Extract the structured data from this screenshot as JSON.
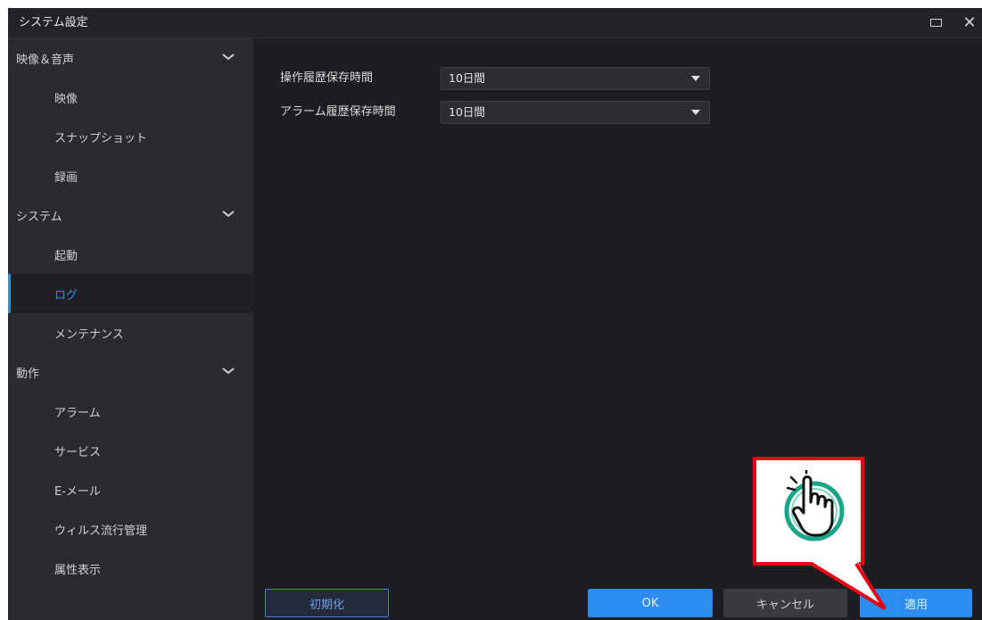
{
  "window": {
    "title": "システム設定",
    "controls": {
      "maximize_icon": "maximize-icon",
      "close_icon": "close-icon",
      "close_glyph": "✕"
    }
  },
  "sidebar": {
    "items": [
      {
        "label": "映像＆音声",
        "type": "group",
        "expanded": true
      },
      {
        "label": "映像",
        "type": "item"
      },
      {
        "label": "スナップショット",
        "type": "item"
      },
      {
        "label": "録画",
        "type": "item"
      },
      {
        "label": "システム",
        "type": "group",
        "expanded": true
      },
      {
        "label": "起動",
        "type": "item"
      },
      {
        "label": "ログ",
        "type": "item",
        "selected": true
      },
      {
        "label": "メンテナンス",
        "type": "item"
      },
      {
        "label": "動作",
        "type": "group",
        "expanded": true
      },
      {
        "label": "アラーム",
        "type": "item"
      },
      {
        "label": "サービス",
        "type": "item"
      },
      {
        "label": "E-メール",
        "type": "item"
      },
      {
        "label": "ウィルス流行管理",
        "type": "item"
      },
      {
        "label": "属性表示",
        "type": "item"
      }
    ]
  },
  "main": {
    "fields": [
      {
        "label": "操作履歴保存時間",
        "value": "10日間"
      },
      {
        "label": "アラーム履歴保存時間",
        "value": "10日間"
      }
    ]
  },
  "footer": {
    "reset_label": "初期化",
    "ok_label": "OK",
    "cancel_label": "キャンセル",
    "apply_label": "適用"
  },
  "annotation": {
    "icon": "pointing-hand-icon",
    "border_color": "#e60012",
    "ring_color": "#1aa48a"
  },
  "colors": {
    "accent": "#2d8cf0",
    "window_bg": "#1d1e22",
    "sidebar_bg": "#2a2b30"
  }
}
